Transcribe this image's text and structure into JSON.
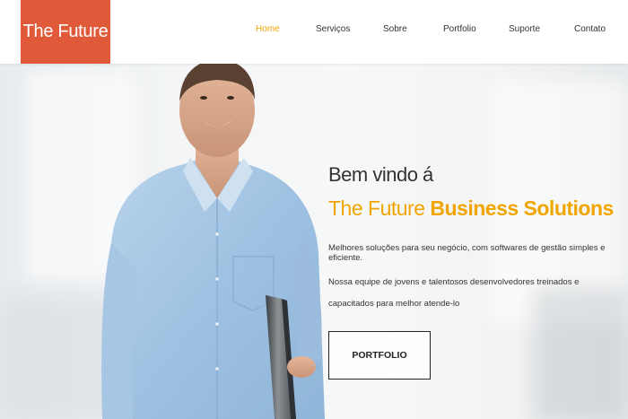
{
  "brand": {
    "logo_text": "The Future",
    "logo_color": "#e05a3a"
  },
  "nav": {
    "items": [
      {
        "label": "Home",
        "active": true
      },
      {
        "label": "Serviços",
        "active": false
      },
      {
        "label": "Sobre",
        "active": false
      },
      {
        "label": "Portfolio",
        "active": false
      },
      {
        "label": "Suporte",
        "active": false
      },
      {
        "label": "Contato",
        "active": false
      }
    ],
    "active_color": "#f0a500"
  },
  "hero": {
    "welcome": "Bem vindo á",
    "headline_light": "The Future",
    "headline_bold": "Business Solutions",
    "paragraph1": "Melhores soluções para seu negócio, com softwares de gestão simples e eficiente.",
    "paragraph2": "Nossa equipe de jovens e talentosos desenvolvedores treinados e capacitados para melhor atende-lo",
    "button_label": "PORTFOLIO",
    "accent_color": "#f0a500"
  }
}
